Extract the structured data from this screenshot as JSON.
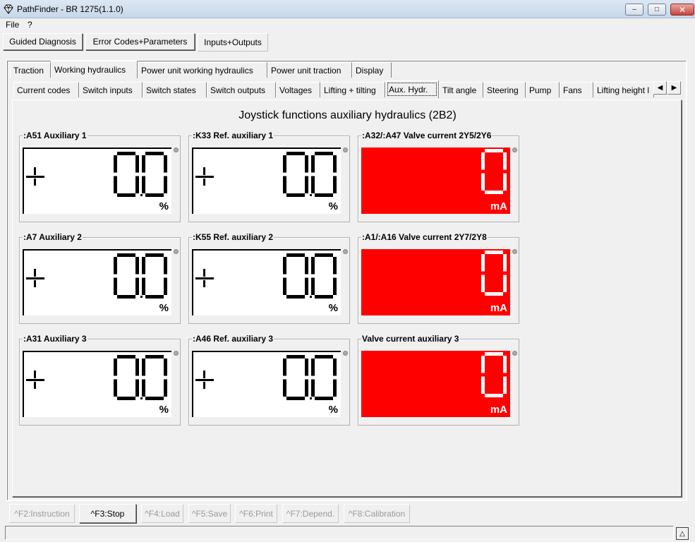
{
  "window": {
    "title": "PathFinder - BR 1275(1.1.0)",
    "icon": "diamond-app-icon",
    "min_glyph": "–",
    "max_glyph": "□",
    "close_glyph": "✕"
  },
  "menu": [
    "File",
    "?"
  ],
  "main_tabs": [
    "Guided Diagnosis",
    "Error Codes+Parameters",
    "Inputs+Outputs"
  ],
  "section_tabs": [
    "Traction",
    "Working hydraulics",
    "Power unit working hydraulics",
    "Power unit traction",
    "Display"
  ],
  "sub_tabs": [
    "Current codes",
    "Switch inputs",
    "Switch states",
    "Switch outputs",
    "Voltages",
    "Lifting + tilting",
    "Aux. Hydr.",
    "Tilt angle",
    "Steering",
    "Pump",
    "Fans",
    "Lifting height l"
  ],
  "scroll_left": "◀",
  "scroll_right": "▶",
  "heading": "Joystick functions auxiliary hydraulics (2B2)",
  "gauges": [
    {
      "label": ":A51 Auxiliary 1",
      "value": "0.0",
      "unit": "%",
      "style": "white"
    },
    {
      "label": ":K33 Ref. auxiliary 1",
      "value": "0.0",
      "unit": "%",
      "style": "white"
    },
    {
      "label": ":A32/:A47 Valve current 2Y5/2Y6",
      "value": "0",
      "unit": "mA",
      "style": "red"
    },
    {
      "label": ":A7 Auxiliary 2",
      "value": "0.0",
      "unit": "%",
      "style": "white"
    },
    {
      "label": ":K55 Ref. auxiliary 2",
      "value": "0.0",
      "unit": "%",
      "style": "white"
    },
    {
      "label": ":A1/:A16 Valve current 2Y7/2Y8",
      "value": "0",
      "unit": "mA",
      "style": "red"
    },
    {
      "label": ":A31 Auxiliary 3",
      "value": "0.0",
      "unit": "%",
      "style": "white"
    },
    {
      "label": ":A46 Ref. auxiliary 3",
      "value": "0.0",
      "unit": "%",
      "style": "white"
    },
    {
      "label": "Valve current auxiliary 3",
      "value": "0",
      "unit": "mA",
      "style": "red"
    }
  ],
  "colors": {
    "red_display": "#ff0000",
    "segment_dark": "#000000",
    "segment_light": "#ffffff"
  },
  "function_buttons": [
    {
      "label": "^F2:Instruction",
      "enabled": false
    },
    {
      "label": "^F3:Stop",
      "enabled": true
    },
    {
      "label": "^F4:Load",
      "enabled": false
    },
    {
      "label": "^F5:Save",
      "enabled": false
    },
    {
      "label": "^F6:Print",
      "enabled": false
    },
    {
      "label": "^F7:Depend.",
      "enabled": false
    },
    {
      "label": "^F8:Calibration",
      "enabled": false
    }
  ],
  "status_button": "△"
}
